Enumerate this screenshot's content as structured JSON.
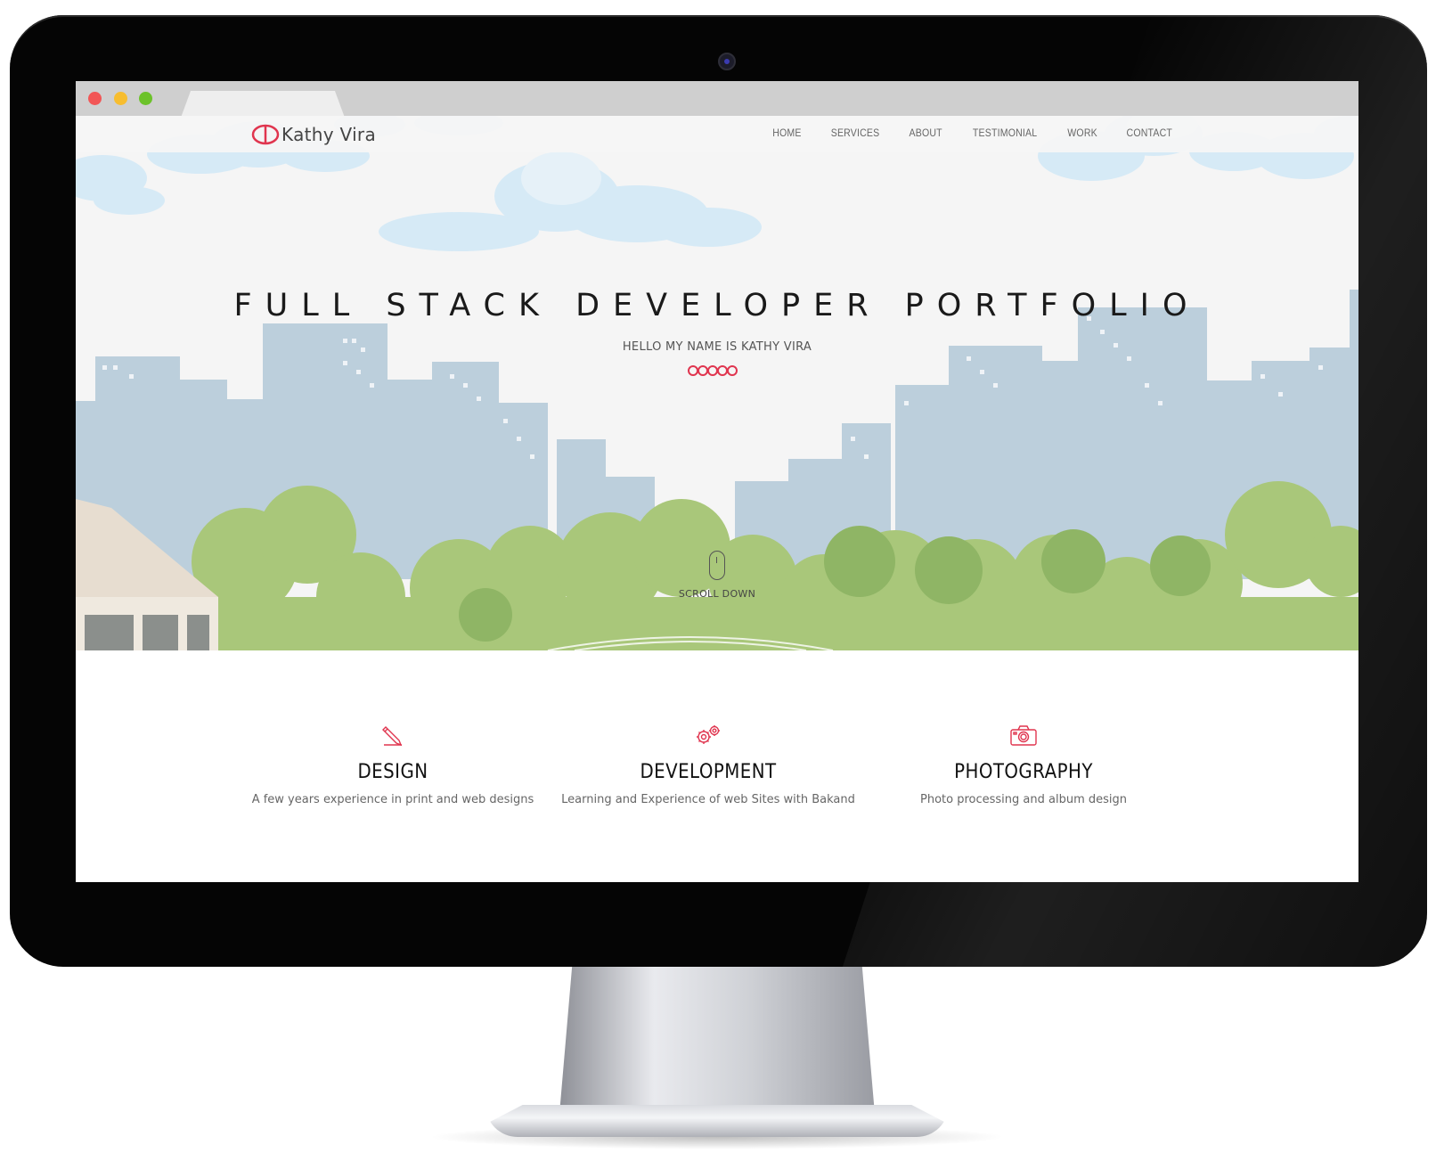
{
  "browser": {
    "controls": [
      "close",
      "minimize",
      "maximize"
    ]
  },
  "site": {
    "logo_text": "Kathy Vira",
    "nav": [
      {
        "label": "HOME"
      },
      {
        "label": "SERVICES"
      },
      {
        "label": "ABOUT"
      },
      {
        "label": "TESTIMONIAL"
      },
      {
        "label": "WORK"
      },
      {
        "label": "CONTACT"
      }
    ],
    "hero": {
      "title": "FULL STACK DEVELOPER PORTFOLIO",
      "subtitle": "HELLO MY NAME IS KATHY VIRA",
      "scroll_label": "SCROLL DOWN"
    },
    "services": [
      {
        "icon": "pencil-icon",
        "title": "DESIGN",
        "text": "A few years experience in print and web designs"
      },
      {
        "icon": "gears-icon",
        "title": "DEVELOPMENT",
        "text": "Learning and Experience of web Sites with Bakand"
      },
      {
        "icon": "camera-icon",
        "title": "PHOTOGRAPHY",
        "text": "Photo processing and album design"
      }
    ]
  },
  "colors": {
    "accent": "#e0354f",
    "sky_cloud": "#d6eaf6",
    "buildings": "#bccfdc",
    "trees": "#a9c77a",
    "page_bg": "#f5f5f5"
  }
}
